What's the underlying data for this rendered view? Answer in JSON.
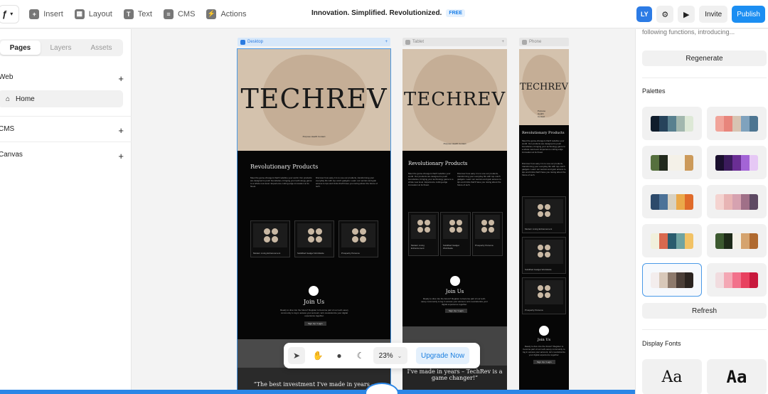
{
  "toolbar": {
    "tools": [
      "Insert",
      "Layout",
      "Text",
      "CMS",
      "Actions"
    ],
    "project_title": "Innovation. Simplified. Revolutionized.",
    "plan_badge": "FREE",
    "user_initials": "LY",
    "invite_label": "Invite",
    "publish_label": "Publish"
  },
  "left_panel": {
    "tabs": [
      "Pages",
      "Layers",
      "Assets"
    ],
    "active_tab": "Pages",
    "sections": {
      "web": "Web",
      "cms": "CMS",
      "canvas": "Canvas"
    },
    "pages": [
      "Home"
    ]
  },
  "canvas": {
    "breakpoints": [
      "Desktop",
      "Tablet",
      "Phone"
    ],
    "site": {
      "brand": "TECHREV",
      "nav": "Purpose   Health   Contact",
      "section_title": "Revolutionary Products",
      "para_left": "Meet the game-changers that'll redefine your world. Our products are designed to push boundaries, bringing your technology game to a whole new level. Experience cutting-edge innovation at its finest.",
      "para_right": "Discover how easy it is to use our products, transforming your everyday life with top-notch gadgets. Learn our secrets and gain access to tips and tricks that'll have you raving about the future of tech.",
      "cards": [
        "Modern Living Enhancement",
        "Solidified Gadget Worldwide",
        "Prosperity Persona"
      ],
      "join_title": "Join Us",
      "join_text": "Ready to dive into the future? Register to become part of our tech-savvy community to log in access your account, let's revolutionize your digital experience together.",
      "join_button": "Sign Up / Login",
      "quote_desktop": "“The best investment I've made in years –",
      "quote_tablet": "I've made in years – TechRev is a game changer!”"
    }
  },
  "floatbar": {
    "zoom": "23%",
    "upgrade_label": "Upgrade Now"
  },
  "right_panel": {
    "truncated_text": "following functions, introducing...",
    "regenerate_label": "Regenerate",
    "palettes_title": "Palettes",
    "refresh_label": "Refresh",
    "fonts_title": "Display Fonts",
    "font_samples": [
      "Aa",
      "Aa"
    ],
    "palettes": [
      [
        "#0f1d2c",
        "#26435b",
        "#58808f",
        "#a2b7ae",
        "#dde8d6"
      ],
      [
        "#f1a49a",
        "#e8857c",
        "#d7c4b2",
        "#7fa2bd",
        "#4d7591"
      ],
      [
        "#56703e",
        "#222a1d",
        "#f4f1e8",
        "#f4f1e8",
        "#cc9a5a"
      ],
      [
        "#1a0f2e",
        "#3b1b5c",
        "#6a2e94",
        "#a364d6",
        "#e6c8f5"
      ],
      [
        "#2d4a6b",
        "#4c7298",
        "#d9d2c2",
        "#eba94a",
        "#e06b2a"
      ],
      [
        "#f4d3d0",
        "#e8b4b4",
        "#d6a2b0",
        "#a07088",
        "#5e4a63"
      ],
      [
        "#f1f0dc",
        "#d9694f",
        "#2a5c6e",
        "#6fa3a1",
        "#f2c265"
      ],
      [
        "#3c5930",
        "#1e2a19",
        "#f4f1e8",
        "#d5a36e",
        "#b06a30"
      ],
      [
        "#f3eded",
        "#d8c8b9",
        "#8d7a6c",
        "#4b3f38",
        "#2b2420"
      ],
      [
        "#f1dcdf",
        "#f4a7b4",
        "#f2718b",
        "#e8415f",
        "#c8193d"
      ]
    ]
  },
  "colors": {
    "accent": "#1b8ef2",
    "hero_bg": "#d4c2ad",
    "dark_bg": "#060606"
  }
}
